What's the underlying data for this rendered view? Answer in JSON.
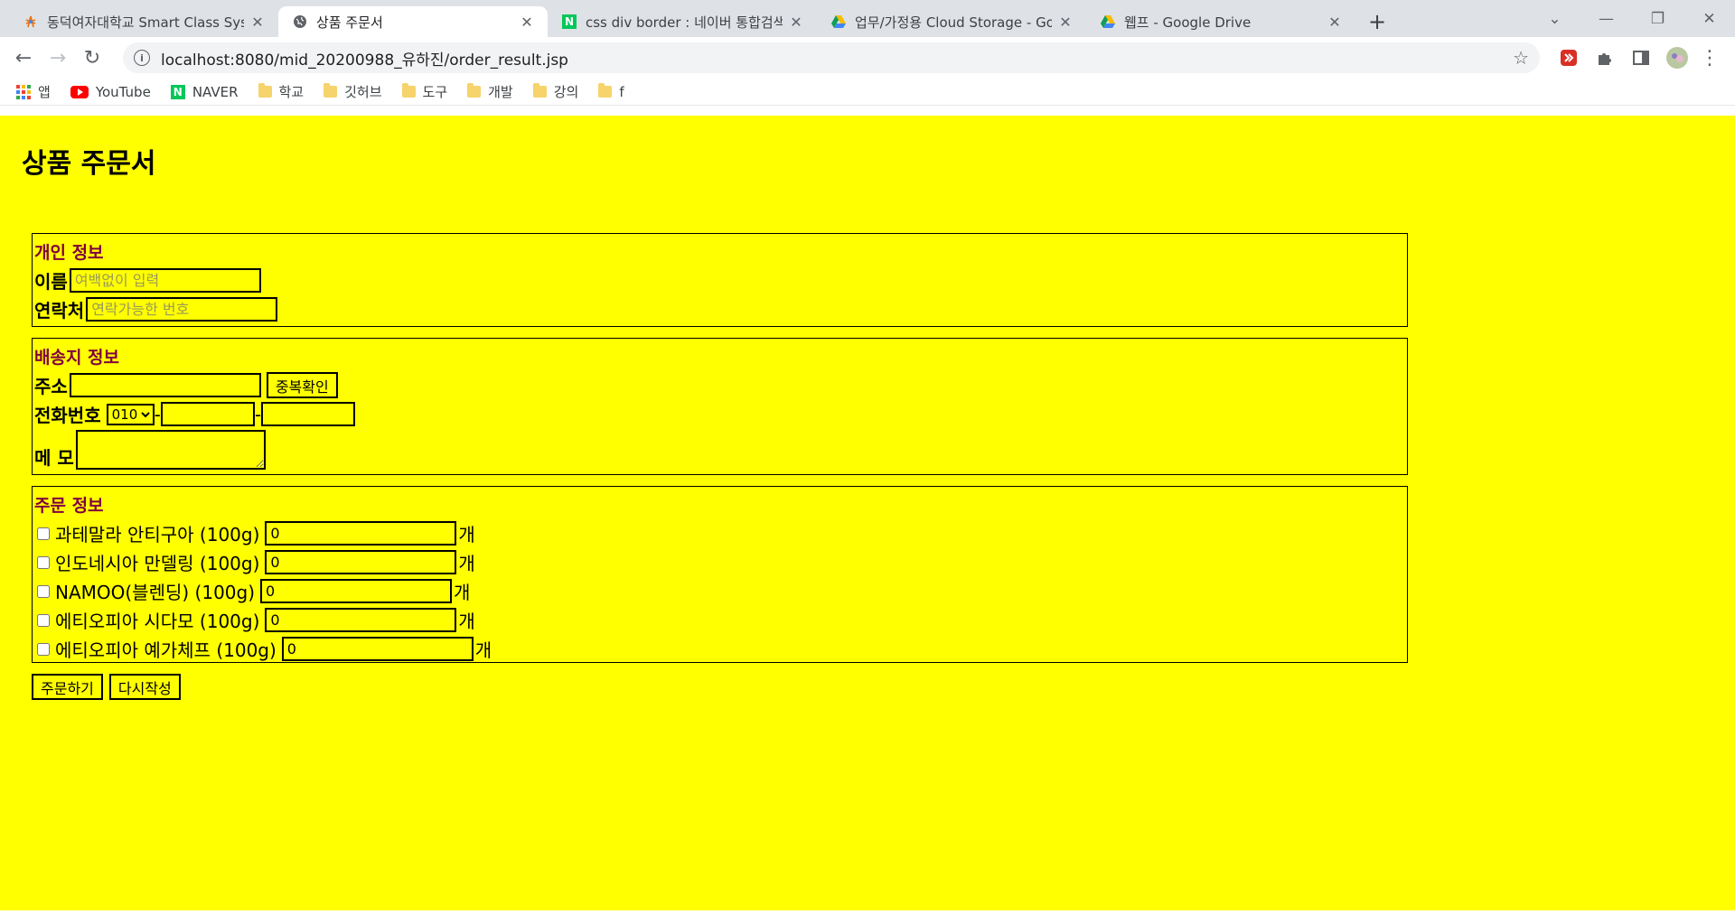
{
  "browser": {
    "tabs": [
      {
        "title": "동덕여자대학교 Smart Class Sys",
        "icon": "ddwu-logo-icon",
        "active": false
      },
      {
        "title": "상품 주문서",
        "icon": "globe-icon",
        "active": true
      },
      {
        "title": "css div border : 네이버 통합검색",
        "icon": "naver-icon",
        "active": false
      },
      {
        "title": "업무/가정용 Cloud Storage - Go",
        "icon": "google-drive-icon",
        "active": false
      },
      {
        "title": "웹프 - Google Drive",
        "icon": "google-drive-icon",
        "active": false
      }
    ],
    "new_tab": "+",
    "url": "localhost:8080/mid_20200988_유하진/order_result.jsp",
    "bookmarks": [
      {
        "label": "앱",
        "icon": "apps-grid-icon"
      },
      {
        "label": "YouTube",
        "icon": "youtube-icon"
      },
      {
        "label": "NAVER",
        "icon": "naver-icon"
      },
      {
        "label": "학교",
        "icon": "folder-icon"
      },
      {
        "label": "깃허브",
        "icon": "folder-icon"
      },
      {
        "label": "도구",
        "icon": "folder-icon"
      },
      {
        "label": "개발",
        "icon": "folder-icon"
      },
      {
        "label": "강의",
        "icon": "folder-icon"
      },
      {
        "label": "f",
        "icon": "folder-icon"
      }
    ]
  },
  "page": {
    "title": "상품 주문서",
    "background": "#ffff00",
    "heading_color": "#800040",
    "personal": {
      "heading": "개인 정보",
      "name_label": "이름",
      "name_placeholder": "여백없이 입력",
      "contact_label": "연락처",
      "contact_placeholder": "연락가능한 번호"
    },
    "shipping": {
      "heading": "배송지 정보",
      "address_label": "주소",
      "check_button": "중복확인",
      "phone_label": "전화번호",
      "phone_prefix": "010",
      "dash": "-",
      "memo_label": "메 모"
    },
    "order": {
      "heading": "주문 정보",
      "unit": "개",
      "items": [
        {
          "name": "과테말라 안티구아 (100g)",
          "qty": "0"
        },
        {
          "name": "인도네시아 만델링 (100g)",
          "qty": "0"
        },
        {
          "name": "NAMOO(블렌딩) (100g)",
          "qty": "0"
        },
        {
          "name": "에티오피아 시다모 (100g)",
          "qty": "0"
        },
        {
          "name": "에티오피아 예가체프 (100g)",
          "qty": "0"
        }
      ]
    },
    "submit_button": "주문하기",
    "reset_button": "다시작성"
  }
}
